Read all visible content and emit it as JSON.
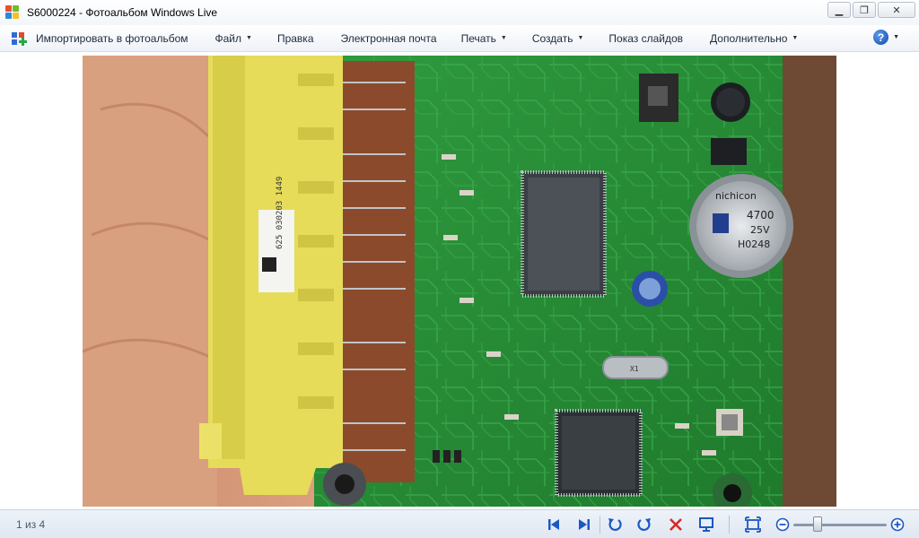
{
  "window": {
    "title": "S6000224 - Фотоальбом Windows Live",
    "minimize_glyph": "▁",
    "maximize_glyph": "❐",
    "close_glyph": "✕"
  },
  "menu": {
    "import_label": "Импортировать в фотоальбом",
    "items": [
      {
        "label": "Файл",
        "has_dropdown": true
      },
      {
        "label": "Правка",
        "has_dropdown": false
      },
      {
        "label": "Электронная почта",
        "has_dropdown": false
      },
      {
        "label": "Печать",
        "has_dropdown": true
      },
      {
        "label": "Создать",
        "has_dropdown": true
      },
      {
        "label": "Показ слайдов",
        "has_dropdown": false
      },
      {
        "label": "Дополнительно",
        "has_dropdown": true
      }
    ],
    "help_glyph": "?"
  },
  "photo": {
    "subject": "circuit-board-photo",
    "component_labels": {
      "cap_brand": "nichicon",
      "cap_value": "4700",
      "cap_voltage": "25V",
      "cap_code": "H0248",
      "label_sticker": "625 030203 1449",
      "crystal_code": "X1"
    }
  },
  "statusbar": {
    "counter": "1 из 4"
  },
  "icons": {
    "prev": "previous-icon",
    "next": "next-icon",
    "rotate_ccw": "rotate-left-icon",
    "rotate_cw": "rotate-right-icon",
    "delete": "delete-icon",
    "slideshow": "slideshow-icon",
    "fit": "actual-size-icon",
    "zoom_out": "zoom-out-icon",
    "zoom_in": "zoom-in-icon"
  },
  "colors": {
    "accent_blue": "#1c57c4",
    "delete_red": "#d42a2a",
    "pcb_green": "#2d9a3e"
  }
}
